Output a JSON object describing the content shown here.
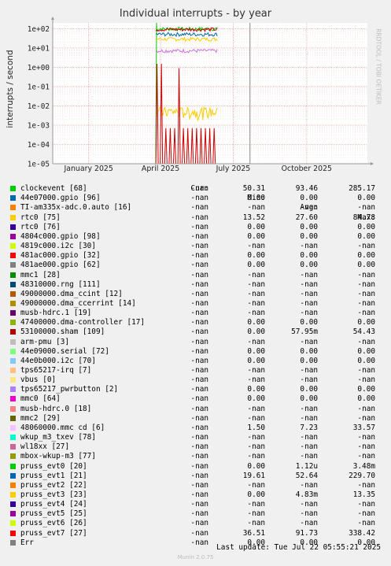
{
  "chart_data": {
    "type": "line",
    "title": "Individual interrupts - by year",
    "ylabel": "interrupts / second",
    "yscale": "log",
    "ylim": [
      1e-05,
      200
    ],
    "yticks": [
      "1e-05",
      "1e-04",
      "1e-03",
      "1e-02",
      "1e-01",
      "1e+00",
      "1e+01",
      "1e+02"
    ],
    "xlim": [
      "2024-11-17",
      "2025-12-16"
    ],
    "xticks": [
      {
        "label": "January 2025",
        "date": "2025-01-01"
      },
      {
        "label": "April 2025",
        "date": "2025-04-01"
      },
      {
        "label": "July 2025",
        "date": "2025-07-01"
      },
      {
        "label": "October 2025",
        "date": "2025-10-01"
      }
    ],
    "grid": true,
    "now_marker": "2025-07-22",
    "data_start": "2025-03-26",
    "data_end": "2025-06-11",
    "series": [
      {
        "name": "clockevent [68]",
        "color": "#00cc00",
        "level": 95,
        "spikes": [
          [
            1e-05,
            285
          ]
        ]
      },
      {
        "name": "rtc0 [75]",
        "color": "#ffcc00",
        "level": 28
      },
      {
        "name": "mmc0 [64]",
        "color": "#cc77dd",
        "level": 7
      },
      {
        "name": "pruss_evt1 [21]",
        "color": "#0066b3",
        "level": 50
      },
      {
        "name": "pruss_evt3 [23]",
        "color": "#ffcc00",
        "level": 0.003,
        "noise": 0.004
      },
      {
        "name": "pruss_evt7 [27]",
        "color": "#cc0000",
        "level": 90
      },
      {
        "name": "53100000.sham [109]",
        "color": "#cc0000",
        "level": 0.0007,
        "pulses": true
      }
    ]
  },
  "legend": {
    "headers": {
      "cur": "Cur:",
      "min": "Min:",
      "avg": "Avg:",
      "max": "Max:"
    },
    "rows": [
      {
        "name": "clockevent [68]",
        "color": "#00cc00",
        "cur": "-nan",
        "min": "50.31",
        "avg": "93.46",
        "max": "285.17"
      },
      {
        "name": "44e07000.gpio [96]",
        "color": "#0066b3",
        "cur": "-nan",
        "min": "0.00",
        "avg": "0.00",
        "max": "0.00"
      },
      {
        "name": "TI-am335x-adc.0.auto [16]",
        "color": "#ff8000",
        "cur": "-nan",
        "min": "-nan",
        "avg": "-nan",
        "max": "-nan"
      },
      {
        "name": "rtc0 [75]",
        "color": "#ffcc00",
        "cur": "-nan",
        "min": "13.52",
        "avg": "27.60",
        "max": "84.78"
      },
      {
        "name": "rtc0 [76]",
        "color": "#330099",
        "cur": "-nan",
        "min": "0.00",
        "avg": "0.00",
        "max": "0.00"
      },
      {
        "name": "4804c000.gpio [98]",
        "color": "#990099",
        "cur": "-nan",
        "min": "0.00",
        "avg": "0.00",
        "max": "0.00"
      },
      {
        "name": "4819c000.i2c [30]",
        "color": "#ccff00",
        "cur": "-nan",
        "min": "-nan",
        "avg": "-nan",
        "max": "-nan"
      },
      {
        "name": "481ac000.gpio [32]",
        "color": "#ff0000",
        "cur": "-nan",
        "min": "0.00",
        "avg": "0.00",
        "max": "0.00"
      },
      {
        "name": "481ae000.gpio [62]",
        "color": "#808080",
        "cur": "-nan",
        "min": "0.00",
        "avg": "0.00",
        "max": "0.00"
      },
      {
        "name": "mmc1 [28]",
        "color": "#008f00",
        "cur": "-nan",
        "min": "-nan",
        "avg": "-nan",
        "max": "-nan"
      },
      {
        "name": "48310000.rng [111]",
        "color": "#00487d",
        "cur": "-nan",
        "min": "-nan",
        "avg": "-nan",
        "max": "-nan"
      },
      {
        "name": "49000000.dma_ccint [12]",
        "color": "#b35a00",
        "cur": "-nan",
        "min": "-nan",
        "avg": "-nan",
        "max": "-nan"
      },
      {
        "name": "49000000.dma_ccerrint [14]",
        "color": "#b38f00",
        "cur": "-nan",
        "min": "-nan",
        "avg": "-nan",
        "max": "-nan"
      },
      {
        "name": "musb-hdrc.1 [19]",
        "color": "#6b006b",
        "cur": "-nan",
        "min": "-nan",
        "avg": "-nan",
        "max": "-nan"
      },
      {
        "name": "47400000.dma-controller [17]",
        "color": "#8fb300",
        "cur": "-nan",
        "min": "0.00",
        "avg": "0.00",
        "max": "0.00"
      },
      {
        "name": "53100000.sham [109]",
        "color": "#b30000",
        "cur": "-nan",
        "min": "0.00",
        "avg": "57.95m",
        "max": "54.43"
      },
      {
        "name": "arm-pmu [3]",
        "color": "#bebebe",
        "cur": "-nan",
        "min": "-nan",
        "avg": "-nan",
        "max": "-nan"
      },
      {
        "name": "44e09000.serial [72]",
        "color": "#80ff80",
        "cur": "-nan",
        "min": "0.00",
        "avg": "0.00",
        "max": "0.00"
      },
      {
        "name": "44e0b000.i2c [70]",
        "color": "#80c9ff",
        "cur": "-nan",
        "min": "0.00",
        "avg": "0.00",
        "max": "0.00"
      },
      {
        "name": "tps65217-irq [7]",
        "color": "#ffc080",
        "cur": "-nan",
        "min": "-nan",
        "avg": "-nan",
        "max": "-nan"
      },
      {
        "name": "vbus [0]",
        "color": "#ffe680",
        "cur": "-nan",
        "min": "-nan",
        "avg": "-nan",
        "max": "-nan"
      },
      {
        "name": "tps65217_pwrbutton [2]",
        "color": "#aa80ff",
        "cur": "-nan",
        "min": "0.00",
        "avg": "0.00",
        "max": "0.00"
      },
      {
        "name": "mmc0 [64]",
        "color": "#ee00cc",
        "cur": "-nan",
        "min": "0.00",
        "avg": "0.00",
        "max": "0.00"
      },
      {
        "name": "musb-hdrc.0 [18]",
        "color": "#ff8080",
        "cur": "-nan",
        "min": "-nan",
        "avg": "-nan",
        "max": "-nan"
      },
      {
        "name": "mmc2 [29]",
        "color": "#666600",
        "cur": "-nan",
        "min": "-nan",
        "avg": "-nan",
        "max": "-nan"
      },
      {
        "name": "48060000.mmc cd [6]",
        "color": "#ffbfff",
        "cur": "-nan",
        "min": "1.50",
        "avg": "7.23",
        "max": "33.57"
      },
      {
        "name": "wkup_m3_txev [78]",
        "color": "#00ffcc",
        "cur": "-nan",
        "min": "-nan",
        "avg": "-nan",
        "max": "-nan"
      },
      {
        "name": "wl18xx [27]",
        "color": "#cc6699",
        "cur": "-nan",
        "min": "-nan",
        "avg": "-nan",
        "max": "-nan"
      },
      {
        "name": "mbox-wkup-m3 [77]",
        "color": "#999900",
        "cur": "-nan",
        "min": "-nan",
        "avg": "-nan",
        "max": "-nan"
      },
      {
        "name": "pruss_evt0 [20]",
        "color": "#00cc00",
        "cur": "-nan",
        "min": "0.00",
        "avg": "1.12u",
        "max": "3.48m"
      },
      {
        "name": "pruss_evt1 [21]",
        "color": "#0066b3",
        "cur": "-nan",
        "min": "19.61",
        "avg": "52.64",
        "max": "229.70"
      },
      {
        "name": "pruss_evt2 [22]",
        "color": "#ff8000",
        "cur": "-nan",
        "min": "-nan",
        "avg": "-nan",
        "max": "-nan"
      },
      {
        "name": "pruss_evt3 [23]",
        "color": "#ffcc00",
        "cur": "-nan",
        "min": "0.00",
        "avg": "4.83m",
        "max": "13.35"
      },
      {
        "name": "pruss_evt4 [24]",
        "color": "#330099",
        "cur": "-nan",
        "min": "-nan",
        "avg": "-nan",
        "max": "-nan"
      },
      {
        "name": "pruss_evt5 [25]",
        "color": "#990099",
        "cur": "-nan",
        "min": "-nan",
        "avg": "-nan",
        "max": "-nan"
      },
      {
        "name": "pruss_evt6 [26]",
        "color": "#ccff00",
        "cur": "-nan",
        "min": "-nan",
        "avg": "-nan",
        "max": "-nan"
      },
      {
        "name": "pruss_evt7 [27]",
        "color": "#ff0000",
        "cur": "-nan",
        "min": "36.51",
        "avg": "91.73",
        "max": "338.42"
      },
      {
        "name": "Err",
        "color": "#808080",
        "cur": "-nan",
        "min": "0.00",
        "avg": "0.00",
        "max": "0.00"
      }
    ]
  },
  "last_update": "Last update: Tue Jul 22 05:55:21 2025",
  "footer": "Munin 2.0.75",
  "vendor": "RRDTOOL / TOBI OETIKER"
}
